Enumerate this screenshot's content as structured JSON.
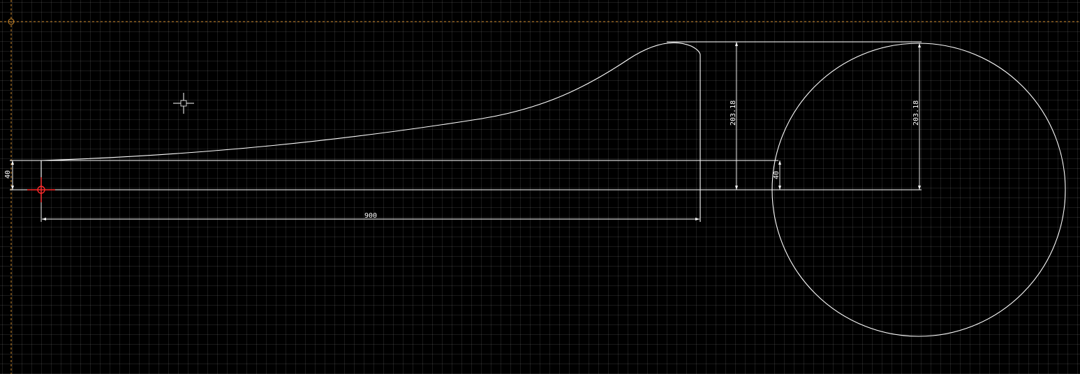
{
  "viewport": {
    "background": "#000000",
    "grid_color": "#2b2b2b",
    "guide_color": "#d08a2a",
    "origin_color": "#ff2a2a",
    "geometry_color": "#ffffff"
  },
  "dimensions": {
    "left_height": "40",
    "bottom_length": "900",
    "middle_height": "203.18",
    "small_height": "40",
    "circle_height": "203.18"
  },
  "icons": {
    "origin_marker": "origin-crosshair-icon",
    "guide_snap": "snap-circle-icon",
    "cursor": "crosshair-cursor-icon"
  }
}
